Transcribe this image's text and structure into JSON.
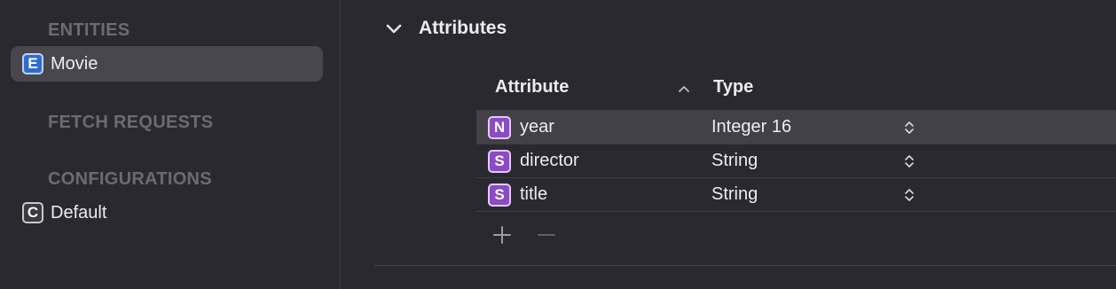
{
  "sidebar": {
    "sections": [
      {
        "title": "ENTITIES"
      },
      {
        "title": "FETCH REQUESTS"
      },
      {
        "title": "CONFIGURATIONS"
      }
    ],
    "entities": [
      {
        "badge": "E",
        "label": "Movie",
        "selected": true
      }
    ],
    "configurations": [
      {
        "badge": "C",
        "label": "Default"
      }
    ]
  },
  "main": {
    "title": "Attributes",
    "columns": {
      "attribute": "Attribute",
      "type": "Type"
    },
    "sort": {
      "column": "Attribute",
      "direction": "ascending"
    },
    "rows": [
      {
        "badge": "N",
        "name": "year",
        "type": "Integer 16",
        "selected": true
      },
      {
        "badge": "S",
        "name": "director",
        "type": "String"
      },
      {
        "badge": "S",
        "name": "title",
        "type": "String"
      }
    ]
  },
  "icons": {
    "disclosure": "chevron-down-icon",
    "sort": "chevron-up-icon",
    "stepper": "up-down-stepper-icon",
    "add": "plus-icon",
    "remove": "minus-icon"
  },
  "colors": {
    "background": "#2b2930",
    "selection": "#48474d",
    "entity_badge": "#2f6bd0",
    "attribute_badge": "#8a4bc4",
    "section_header": "#6c6a72"
  }
}
